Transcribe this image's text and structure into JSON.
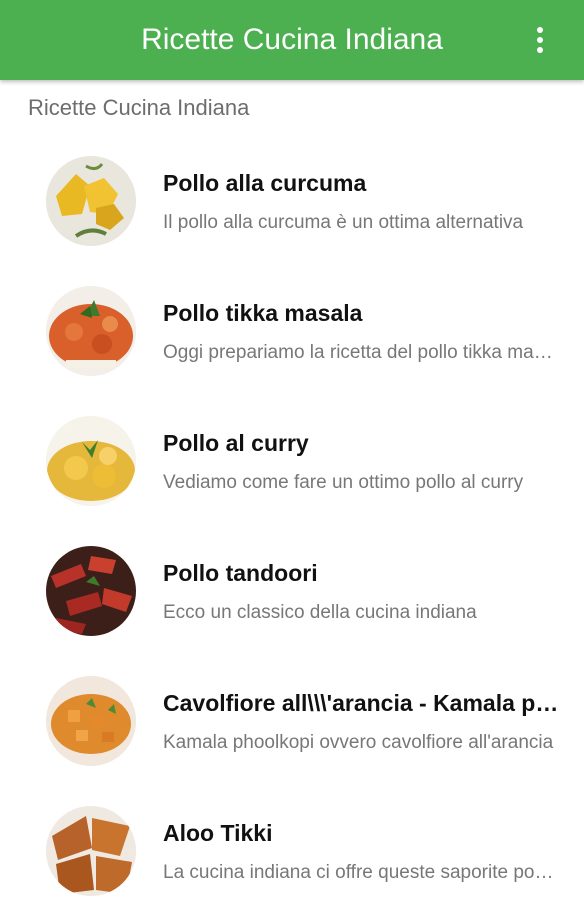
{
  "appbar": {
    "title": "Ricette Cucina Indiana",
    "menu_icon": "more-vert-icon"
  },
  "section": {
    "header": "Ricette Cucina Indiana"
  },
  "recipes": [
    {
      "title": "Pollo alla curcuma",
      "description": "Il pollo alla curcuma è un ottima alternativa"
    },
    {
      "title": "Pollo tikka masala",
      "description": "Oggi prepariamo la ricetta del pollo tikka masala"
    },
    {
      "title": "Pollo al curry",
      "description": "Vediamo come fare un ottimo pollo al curry"
    },
    {
      "title": "Pollo tandoori",
      "description": "Ecco un classico della cucina indiana"
    },
    {
      "title": "Cavolfiore all\\\\\\'arancia - Kamala phoolkopi",
      "description": "Kamala phoolkopi ovvero cavolfiore all'arancia"
    },
    {
      "title": "Aloo Tikki",
      "description": "La cucina indiana ci offre queste saporite polpette"
    }
  ],
  "colors": {
    "primary": "#4caf50",
    "title_text": "#111111",
    "subtitle_text": "#777777"
  }
}
